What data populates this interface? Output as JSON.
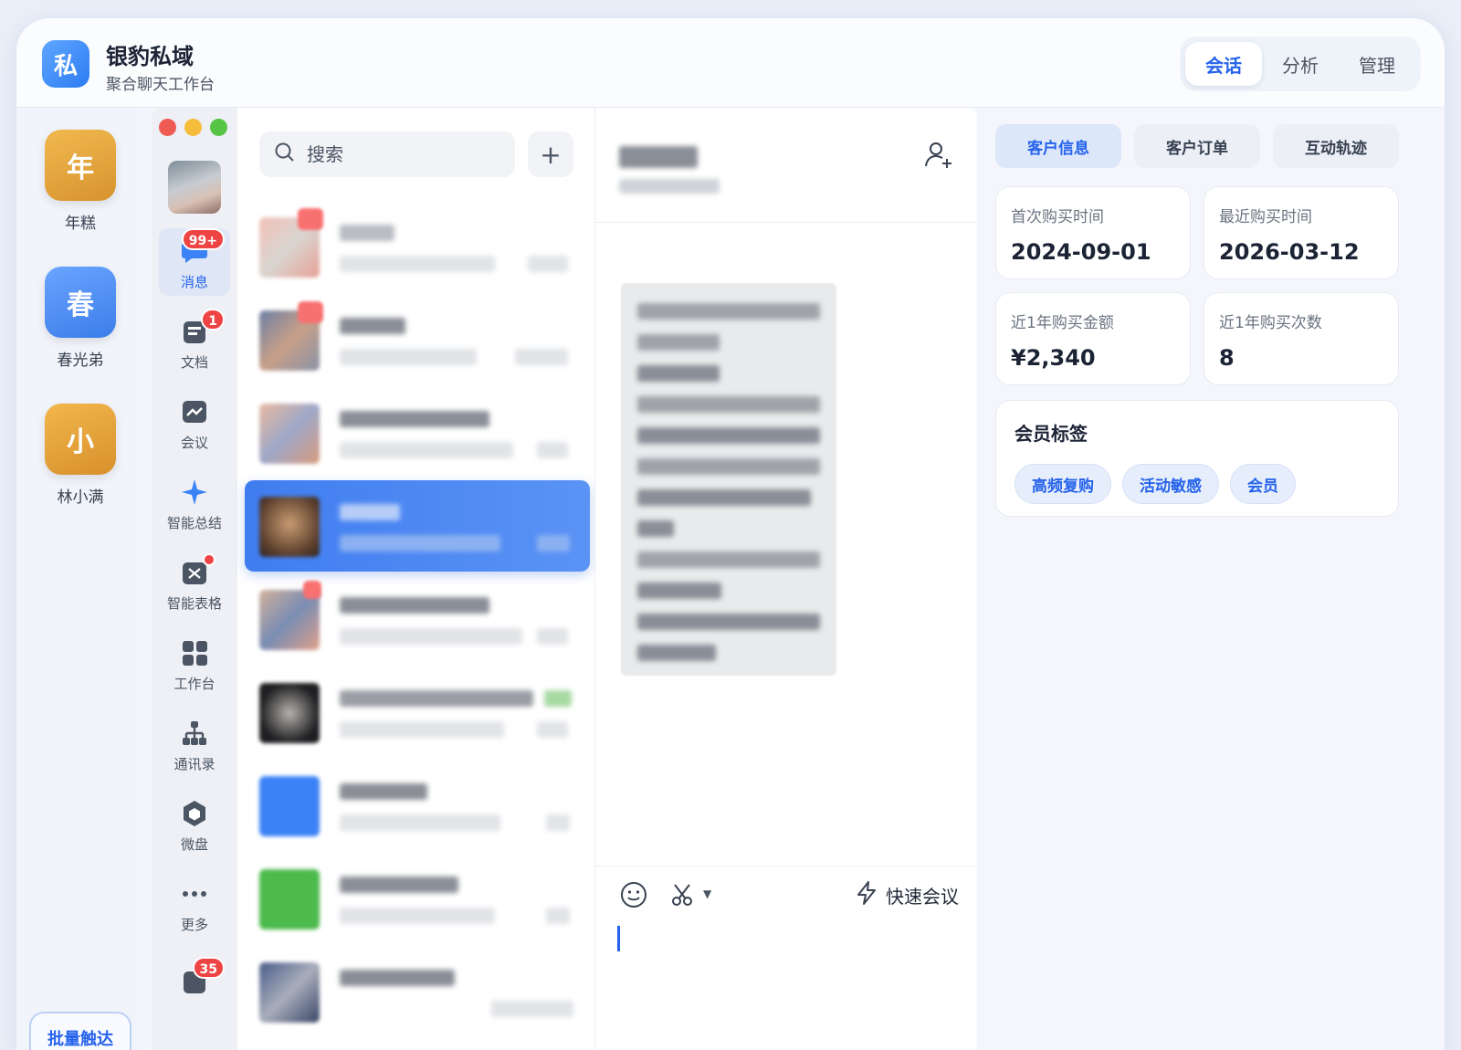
{
  "app": {
    "logo_char": "私",
    "title": "银豹私域",
    "subtitle": "聚合聊天工作台"
  },
  "mode_tabs": [
    {
      "label": "会话",
      "active": true
    },
    {
      "label": "分析",
      "active": false
    },
    {
      "label": "管理",
      "active": false
    }
  ],
  "accounts": [
    {
      "avatar_char": "年",
      "name": "年糕",
      "color": "#e0a53c"
    },
    {
      "avatar_char": "春",
      "name": "春光弟",
      "color": "#4a8cf3"
    },
    {
      "avatar_char": "小",
      "name": "林小满",
      "color": "#e3a23a"
    }
  ],
  "batch_button": "批量触达",
  "nav": {
    "messages": {
      "label": "消息",
      "badge": "99+"
    },
    "docs": {
      "label": "文档",
      "badge": "1"
    },
    "meeting": {
      "label": "会议"
    },
    "ai_summary": {
      "label": "智能总结"
    },
    "smart_sheet": {
      "label": "智能表格"
    },
    "workbench": {
      "label": "工作台"
    },
    "contacts": {
      "label": "通讯录"
    },
    "drive": {
      "label": "微盘"
    },
    "more": {
      "label": "更多"
    },
    "bottom_badge": "35"
  },
  "search": {
    "placeholder": "搜索"
  },
  "chat_toolbar": {
    "quick_meeting": "快速会议"
  },
  "customer": {
    "tabs": [
      {
        "label": "客户信息",
        "active": true
      },
      {
        "label": "客户订单",
        "active": false
      },
      {
        "label": "互动轨迹",
        "active": false
      }
    ],
    "stats": {
      "first_purchase_label": "首次购买时间",
      "first_purchase_value": "2024-09-01",
      "last_purchase_label": "最近购买时间",
      "last_purchase_value": "2026-03-12",
      "amount_label": "近1年购买金额",
      "amount_value": "¥2,340",
      "count_label": "近1年购买次数",
      "count_value": "8"
    },
    "tags_title": "会员标签",
    "tags": [
      "高频复购",
      "活动敏感",
      "会员"
    ]
  }
}
